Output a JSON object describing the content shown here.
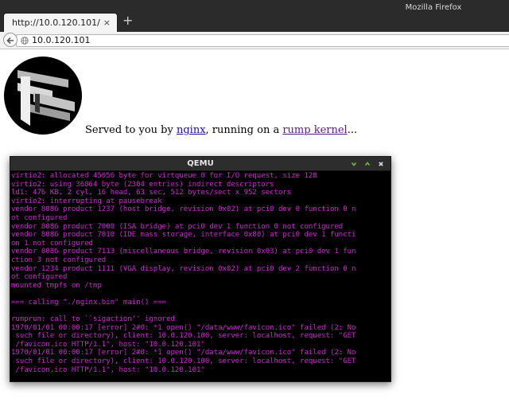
{
  "window": {
    "title": "Mozilla Firefox"
  },
  "tab": {
    "title": "http://10.0.120.101/",
    "close_glyph": "×"
  },
  "new_tab_glyph": "+",
  "url": "10.0.120.101",
  "page": {
    "line_prefix": "Served to you by ",
    "link_nginx": "nginx",
    "line_middle": ", running on a ",
    "link_rump": "rump kernel",
    "line_suffix": "..."
  },
  "qemu": {
    "title": "QEMU",
    "lines": [
      "virtio2: allocated 45056 byte for virtqueue 0 for I/O request, size 128",
      "virtio2: using 36864 byte (2304 entries) indirect descriptors",
      "ld1: 476 KB, 2 cyl, 16 head, 63 sec, 512 bytes/sect x 952 sectors",
      "virtio2: interrupting at pausebreak",
      "vendor 8086 product 1237 (host bridge, revision 0x02) at pci0 dev 0 function 0 n",
      "ot configured",
      "vendor 8086 product 7000 (ISA bridge) at pci0 dev 1 function 0 not configured",
      "vendor 8086 product 7010 (IDE mass storage, interface 0x80) at pci0 dev 1 functi",
      "on 1 not configured",
      "vendor 8086 product 7113 (miscellaneous bridge, revision 0x03) at pci0 dev 1 fun",
      "ction 3 not configured",
      "vendor 1234 product 1111 (VGA display, revision 0x02) at pci0 dev 2 function 0 n",
      "ot configured",
      "mounted tmpfs on /tmp",
      "",
      "=== calling \"./nginx.bin\" main() ===",
      "",
      "rumprun: call to ``sigaction'' ignored",
      "1970/01/01 00:00:17 [error] 2#0: *1 open() \"/data/www/favicon.ico\" failed (2: No",
      " such file or directory), client: 10.0.120.100, server: localhost, request: \"GET",
      " /favicon.ico HTTP/1.1\", host: \"10.0.120.101\"",
      "1970/01/01 00:00:17 [error] 2#0: *1 open() \"/data/www/favicon.ico\" failed (2: No",
      " such file or directory), client: 10.0.120.100, server: localhost, request: \"GET",
      " /favicon.ico HTTP/1.1\", host: \"10.0.120.101\""
    ]
  },
  "colors": {
    "console_text": "#d323d7",
    "link": "#1a0dab",
    "visited_link": "#551a8b"
  },
  "icons": [
    "back-arrow-icon",
    "globe-icon",
    "minimize-icon",
    "maximize-icon",
    "close-icon"
  ]
}
